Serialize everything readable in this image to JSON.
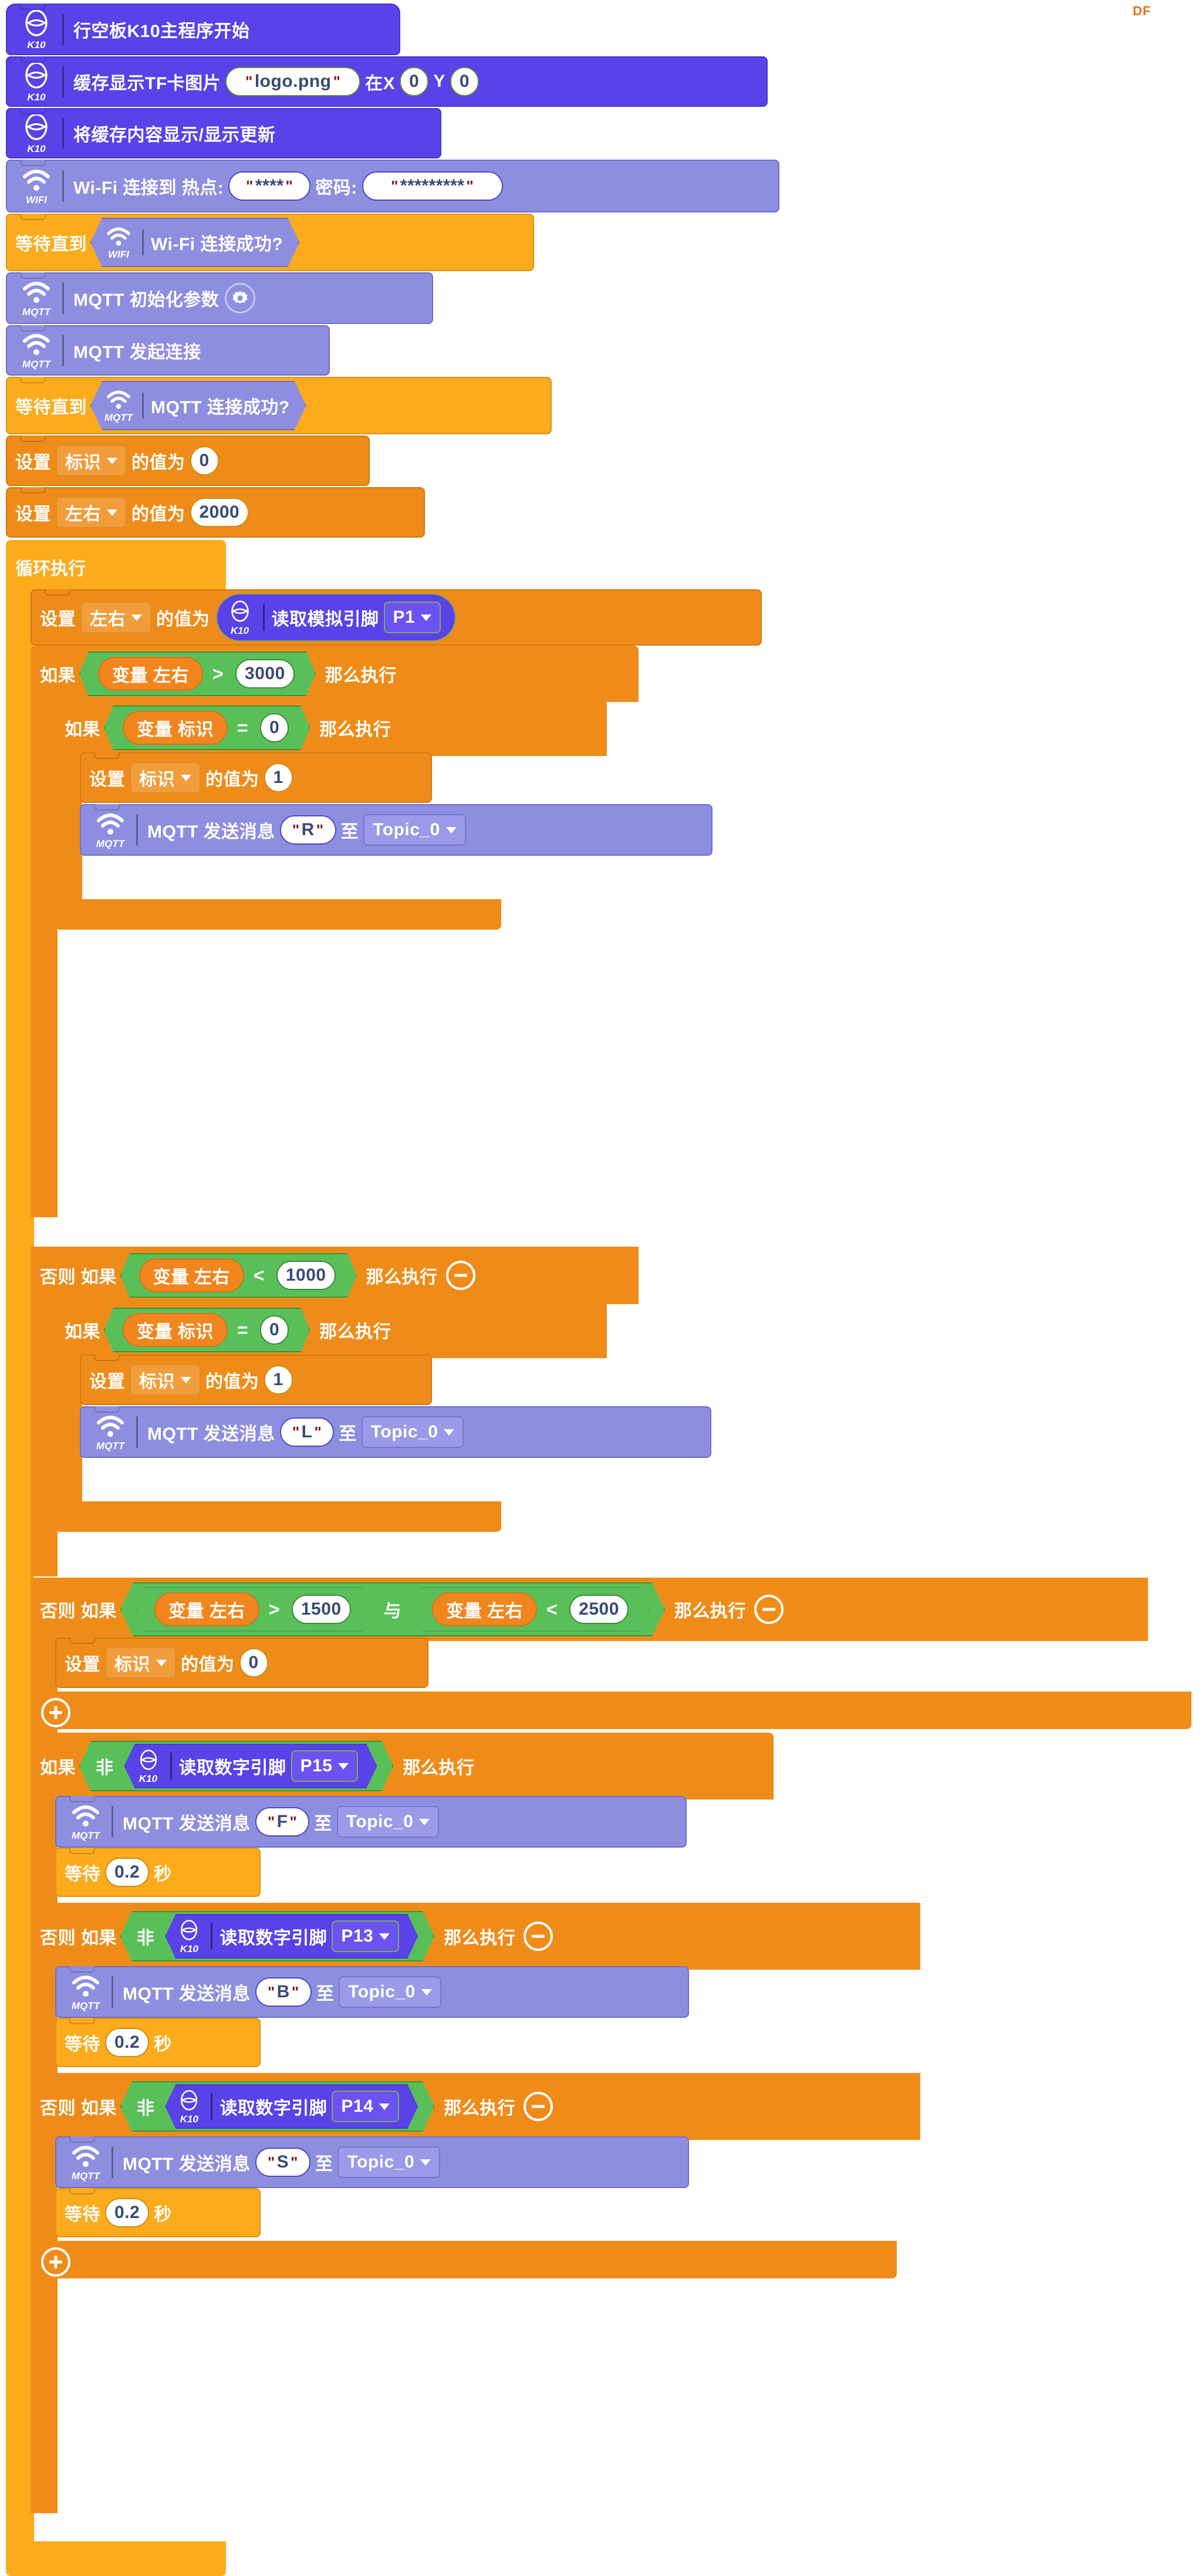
{
  "watermark": "DF",
  "modules": {
    "k10": "K10",
    "wifi": "WIFI",
    "mqtt": "MQTT"
  },
  "program": {
    "hat": {
      "label": "行空板K10主程序开始"
    },
    "show_image": {
      "label": "缓存显示TF卡图片",
      "file": "logo.png",
      "x_label": "在X",
      "x_value": "0",
      "y_label": "Y",
      "y_value": "0"
    },
    "refresh": {
      "label": "将缓存内容显示/显示更新"
    },
    "wifi_connect": {
      "label": "Wi-Fi 连接到 热点:",
      "ssid": "****",
      "password_label": "密码:",
      "password": "*********"
    },
    "wait_until_wifi": {
      "label": "等待直到",
      "condition": "Wi-Fi 连接成功?"
    },
    "mqtt_init": {
      "label": "MQTT 初始化参数"
    },
    "mqtt_connect": {
      "label": "MQTT 发起连接"
    },
    "wait_until_mqtt": {
      "label": "等待直到",
      "condition": "MQTT 连接成功?"
    },
    "set_flag_0": {
      "set": "设置",
      "var": "标识",
      "of_value": "的值为",
      "value": "0"
    },
    "set_lr_2000": {
      "set": "设置",
      "var": "左右",
      "of_value": "的值为",
      "value": "2000"
    },
    "forever": {
      "label": "循环执行"
    },
    "set_lr_analog": {
      "set": "设置",
      "var": "左右",
      "of_value": "的值为",
      "reporter": "读取模拟引脚",
      "pin": "P1"
    },
    "if_lr_gt_3000": {
      "if": "如果",
      "var_prefix": "变量",
      "var": "左右",
      "op": ">",
      "value": "3000",
      "then": "那么执行"
    },
    "if_flag_eq_0_a": {
      "if": "如果",
      "var_prefix": "变量",
      "var": "标识",
      "op": "=",
      "value": "0",
      "then": "那么执行"
    },
    "set_flag_1_a": {
      "set": "设置",
      "var": "标识",
      "of_value": "的值为",
      "value": "1"
    },
    "mqtt_send_R": {
      "label": "MQTT 发送消息",
      "message": "R",
      "to": "至",
      "topic": "Topic_0"
    },
    "elif_lr_lt_1000": {
      "elif": "否则 如果",
      "var_prefix": "变量",
      "var": "左右",
      "op": "<",
      "value": "1000",
      "then": "那么执行"
    },
    "if_flag_eq_0_b": {
      "if": "如果",
      "var_prefix": "变量",
      "var": "标识",
      "op": "=",
      "value": "0",
      "then": "那么执行"
    },
    "set_flag_1_b": {
      "set": "设置",
      "var": "标识",
      "of_value": "的值为",
      "value": "1"
    },
    "mqtt_send_L": {
      "label": "MQTT 发送消息",
      "message": "L",
      "to": "至",
      "topic": "Topic_0"
    },
    "elif_lr_range": {
      "elif": "否则 如果",
      "var_prefix": "变量",
      "left_var": "左右",
      "left_op": ">",
      "left_value": "1500",
      "and": "与",
      "right_var": "左右",
      "right_op": "<",
      "right_value": "2500",
      "then": "那么执行"
    },
    "set_flag_0_c": {
      "set": "设置",
      "var": "标识",
      "of_value": "的值为",
      "value": "0"
    },
    "if_not_p15": {
      "if": "如果",
      "not": "非",
      "reporter": "读取数字引脚",
      "pin": "P15",
      "then": "那么执行"
    },
    "mqtt_send_F": {
      "label": "MQTT 发送消息",
      "message": "F",
      "to": "至",
      "topic": "Topic_0"
    },
    "wait_f": {
      "label": "等待",
      "value": "0.2",
      "unit": "秒"
    },
    "elif_not_p13": {
      "elif": "否则 如果",
      "not": "非",
      "reporter": "读取数字引脚",
      "pin": "P13",
      "then": "那么执行"
    },
    "mqtt_send_B": {
      "label": "MQTT 发送消息",
      "message": "B",
      "to": "至",
      "topic": "Topic_0"
    },
    "wait_b": {
      "label": "等待",
      "value": "0.2",
      "unit": "秒"
    },
    "elif_not_p14": {
      "elif": "否则 如果",
      "not": "非",
      "reporter": "读取数字引脚",
      "pin": "P14",
      "then": "那么执行"
    },
    "mqtt_send_S": {
      "label": "MQTT 发送消息",
      "message": "S",
      "to": "至",
      "topic": "Topic_0"
    },
    "wait_s": {
      "label": "等待",
      "value": "0.2",
      "unit": "秒"
    }
  },
  "colors": {
    "k10_purple": "#5842e8",
    "net_lavender": "#8e8ee0",
    "control_gold": "#fbab1c",
    "variable_orange": "#ef8c19",
    "operator_green": "#59c059",
    "df_orange": "#e2701f"
  }
}
